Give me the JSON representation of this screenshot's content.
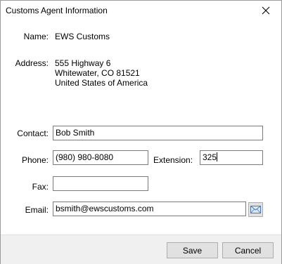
{
  "window": {
    "title": "Customs Agent Information",
    "close_icon": "close-icon"
  },
  "fields": {
    "name_label": "Name:",
    "name_value": "EWS Customs",
    "address_label": "Address:",
    "address_lines": [
      "555 Highway 6",
      "Whitewater, CO 81521",
      "United States of America"
    ],
    "contact_label": "Contact:",
    "contact_value": "Bob Smith",
    "phone_label": "Phone:",
    "phone_value": "(980) 980-8080",
    "extension_label": "Extension:",
    "extension_value": "325",
    "fax_label": "Fax:",
    "fax_value": "",
    "email_label": "Email:",
    "email_value": "bsmith@ewscustoms.com",
    "email_icon": "envelope-icon"
  },
  "buttons": {
    "save_label": "Save",
    "cancel_label": "Cancel"
  }
}
